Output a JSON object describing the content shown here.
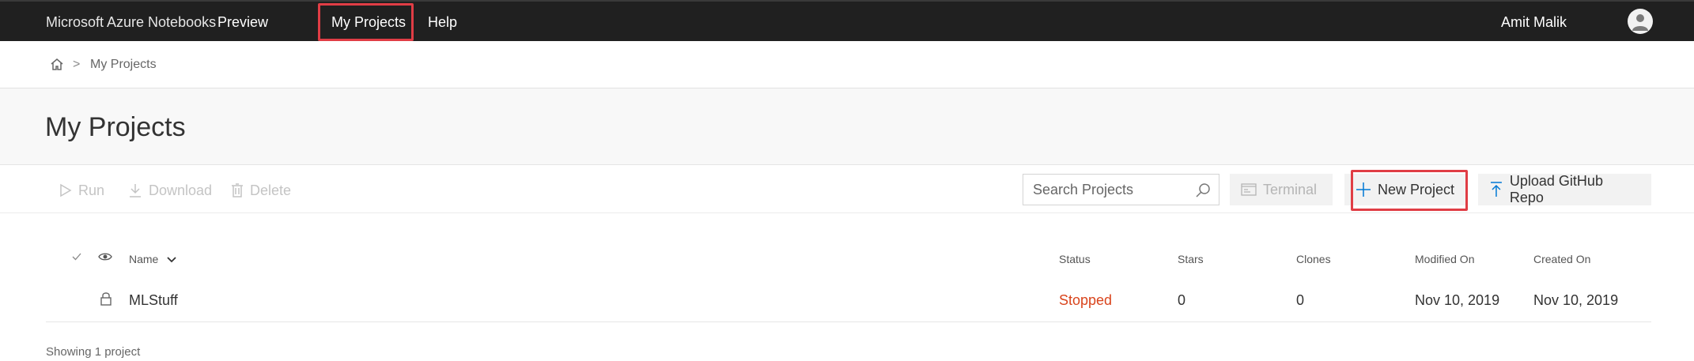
{
  "topbar": {
    "brand": "Microsoft Azure Notebooks",
    "preview": "Preview",
    "nav": [
      {
        "label": "My Projects",
        "highlighted": true
      },
      {
        "label": "Help",
        "highlighted": false
      }
    ],
    "user_name": "Amit Malik",
    "avatar_icon": "person-icon"
  },
  "breadcrumb": {
    "home_icon": "home-icon",
    "separator": ">",
    "current": "My Projects"
  },
  "page": {
    "title": "My Projects"
  },
  "toolbar": {
    "run_label": "Run",
    "download_label": "Download",
    "delete_label": "Delete",
    "search_placeholder": "Search Projects",
    "terminal_label": "Terminal",
    "new_project_label": "New Project",
    "upload_label": "Upload GitHub Repo",
    "new_project_highlighted": true
  },
  "table": {
    "headers": {
      "name": "Name",
      "status": "Status",
      "stars": "Stars",
      "clones": "Clones",
      "modified": "Modified On",
      "created": "Created On"
    },
    "rows": [
      {
        "name": "MLStuff",
        "status": "Stopped",
        "stars": "0",
        "clones": "0",
        "modified": "Nov 10, 2019",
        "created": "Nov 10, 2019"
      }
    ]
  },
  "footer": {
    "count_text": "Showing 1 project"
  },
  "colors": {
    "topbar_bg": "#202020",
    "highlight": "#e03d45",
    "status_stopped": "#d9441c",
    "accent_blue": "#0078d4"
  }
}
